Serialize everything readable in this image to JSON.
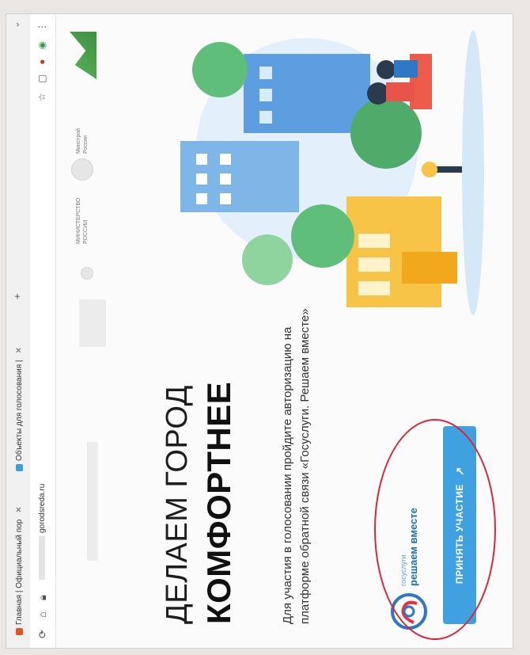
{
  "browser": {
    "tabs": [
      {
        "label": "Главная | Официальный пор",
        "favicon_color": "#e8541e"
      },
      {
        "label": "Объекты для голосования |",
        "favicon_color": "#3f9ed9"
      }
    ],
    "new_tab_symbol": "+",
    "address": {
      "url_visible": "gorodsreda.ru"
    },
    "extension_icons": [
      "star-icon",
      "bookmark-icon",
      "extension-icon",
      "profile-icon",
      "menu-icon"
    ]
  },
  "site": {
    "ministry_label": "МИНИСТЕРСТВО\nРОССИИ",
    "ministry_label_2": "Минстрой\nРоссии"
  },
  "hero": {
    "title_line1": "ДЕЛАЕМ ГОРОД",
    "title_line2": "КОМФОРТНЕЕ",
    "description": "Для участия в голосовании пройдите авторизацию на платформе обратной связи «Госуслуги. Решаем вместе»",
    "brand_small": "госуслуги",
    "brand_large": "решаем вместе",
    "cta_label": "ПРИНЯТЬ УЧАСТИЕ"
  },
  "colors": {
    "cta": "#3fa1e0",
    "highlight_ellipse": "#d7263d",
    "brand_blue": "#1e6fba"
  }
}
